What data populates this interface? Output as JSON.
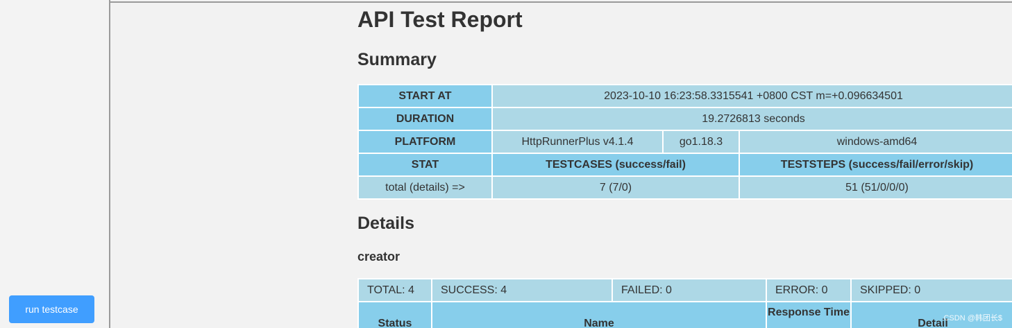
{
  "sidebar": {
    "run_button": "run testcase"
  },
  "report": {
    "title": "API Test Report",
    "summary_heading": "Summary",
    "summary": {
      "start_at_label": "START AT",
      "start_at_value": "2023-10-10 16:23:58.3315541 +0800 CST m=+0.096634501",
      "duration_label": "DURATION",
      "duration_value": "19.2726813 seconds",
      "platform_label": "PLATFORM",
      "platform_runner": "HttpRunnerPlus v4.1.4",
      "platform_go": "go1.18.3",
      "platform_os": "windows-amd64",
      "stat_label": "STAT",
      "testcases_label": "TESTCASES (success/fail)",
      "teststeps_label": "TESTSTEPS (success/fail/error/skip)",
      "total_label": "total (details) =>",
      "testcases_value": "7 (7/0)",
      "teststeps_value": "51 (51/0/0/0)"
    },
    "details_heading": "Details",
    "testcase_name": "creator",
    "testcase_stats": {
      "total": "TOTAL: 4",
      "success": "SUCCESS: 4",
      "failed": "FAILED: 0",
      "error": "ERROR: 0",
      "skipped": "SKIPPED: 0"
    },
    "columns": {
      "status": "Status",
      "name": "Name",
      "response_time": "Response Time",
      "detail": "Detail"
    }
  },
  "watermark": "CSDN @韩团长$",
  "colors": {
    "header": "#87ceeb",
    "cell": "#add8e6",
    "button": "#409eff"
  }
}
